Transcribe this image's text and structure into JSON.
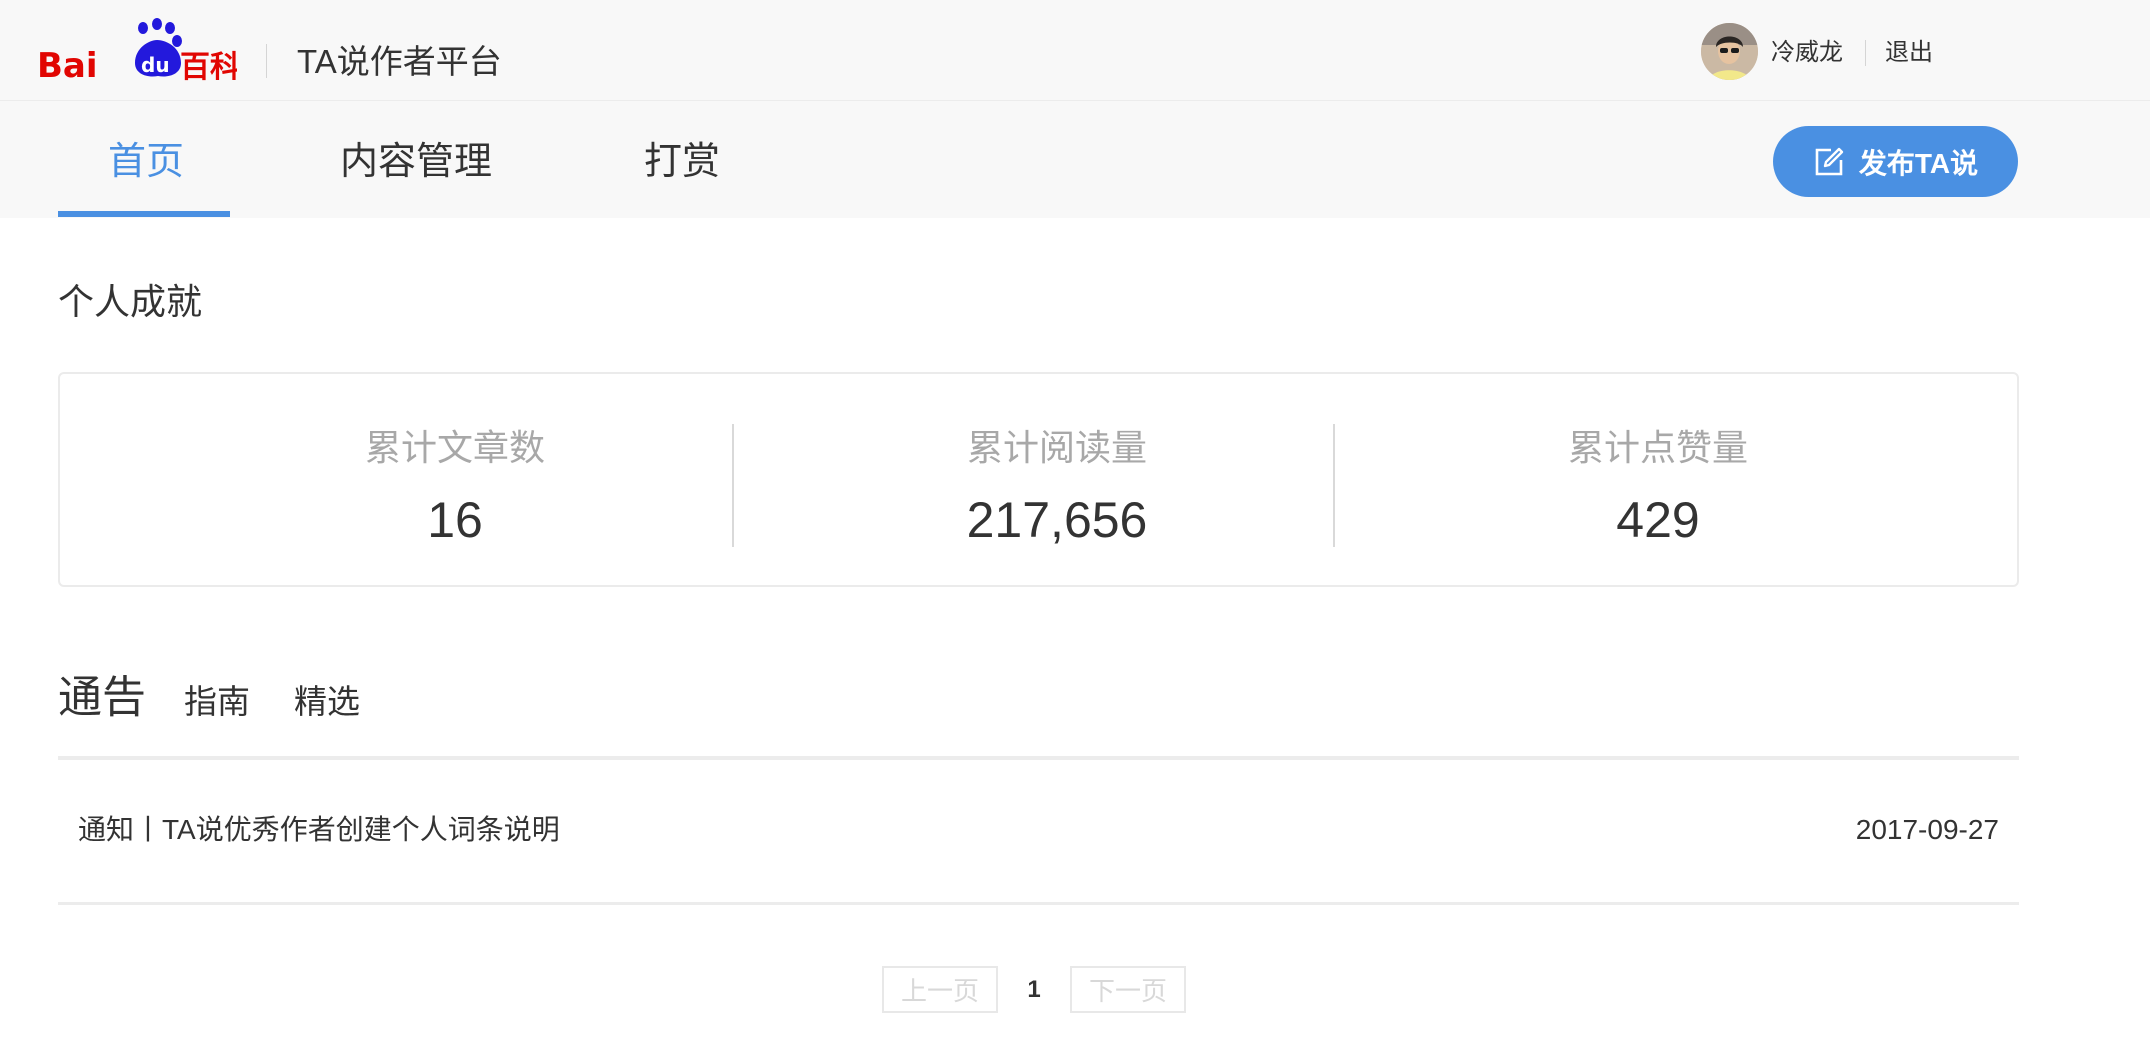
{
  "header": {
    "logo_text": "Baidu百科",
    "platform_title": "TA说作者平台",
    "username": "冷威龙",
    "logout_label": "退出"
  },
  "nav": {
    "items": [
      {
        "label": "首页",
        "active": true
      },
      {
        "label": "内容管理",
        "active": false
      },
      {
        "label": "打赏",
        "active": false
      }
    ],
    "publish_label": "发布TA说"
  },
  "achievements": {
    "title": "个人成就",
    "stats": [
      {
        "label": "累计文章数",
        "value": "16"
      },
      {
        "label": "累计阅读量",
        "value": "217,656"
      },
      {
        "label": "累计点赞量",
        "value": "429"
      }
    ]
  },
  "notices": {
    "tabs": [
      "通告",
      "指南",
      "精选"
    ],
    "rows": [
      {
        "title": "通知丨TA说优秀作者创建个人词条说明",
        "date": "2017-09-27"
      }
    ]
  },
  "pagination": {
    "prev_label": "上一页",
    "current_page": "1",
    "next_label": "下一页"
  },
  "colors": {
    "accent": "#4a90e2",
    "logo_red": "#e10602",
    "logo_blue": "#2319dc"
  }
}
